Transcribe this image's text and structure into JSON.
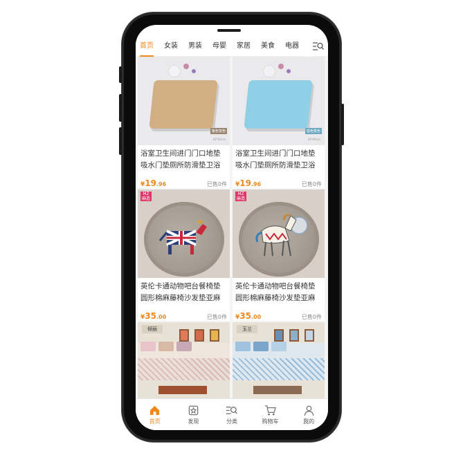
{
  "tabs": [
    {
      "label": "首页",
      "active": true
    },
    {
      "label": "女装"
    },
    {
      "label": "男装"
    },
    {
      "label": "母婴"
    },
    {
      "label": "家居"
    },
    {
      "label": "美食"
    },
    {
      "label": "电器"
    }
  ],
  "products": [
    {
      "title": "浴室卫生间进门门口地垫吸水门垫厕所防滑垫卫浴脚…",
      "price_int": "19",
      "price_dec": ".96",
      "sold": "已售0件",
      "image": "beige-bath-mat",
      "mat_color": "#d2ae84",
      "badge": "紫色变色",
      "caption": "42*60cm"
    },
    {
      "title": "浴室卫生间进门门口地垫吸水门垫厕所防滑垫卫浴脚…",
      "price_int": "19",
      "price_dec": ".96",
      "sold": "已售0件",
      "image": "blue-bath-mat",
      "mat_color": "#8fd0e6",
      "badge": "蓝色变色",
      "caption": "42*60cm"
    },
    {
      "title": "英伦卡通动物吧台餐椅垫圆形棉麻藤椅沙发垫亚麻布…",
      "price_int": "35",
      "price_dec": ".00",
      "sold": "已售0件",
      "image": "union-jack-horse-cushion",
      "brand": "MZ 麻造"
    },
    {
      "title": "英伦卡通动物吧台餐椅垫圆形棉麻藤椅沙发垫亚麻布…",
      "price_int": "35",
      "price_dec": ".00",
      "sold": "已售0件",
      "image": "white-horse-cushion",
      "brand": "MZ 麻造"
    },
    {
      "title": "",
      "image": "floral-sofa-cover",
      "label": "倾丽"
    },
    {
      "title": "",
      "image": "blue-sofa-cover",
      "label": "玉兰"
    }
  ],
  "nav": [
    {
      "label": "首页",
      "icon": "home-icon",
      "active": true
    },
    {
      "label": "发现",
      "icon": "discover-icon"
    },
    {
      "label": "分类",
      "icon": "category-icon"
    },
    {
      "label": "购物车",
      "icon": "cart-icon"
    },
    {
      "label": "我的",
      "icon": "profile-icon"
    }
  ],
  "colors": {
    "accent": "#f0881c"
  }
}
